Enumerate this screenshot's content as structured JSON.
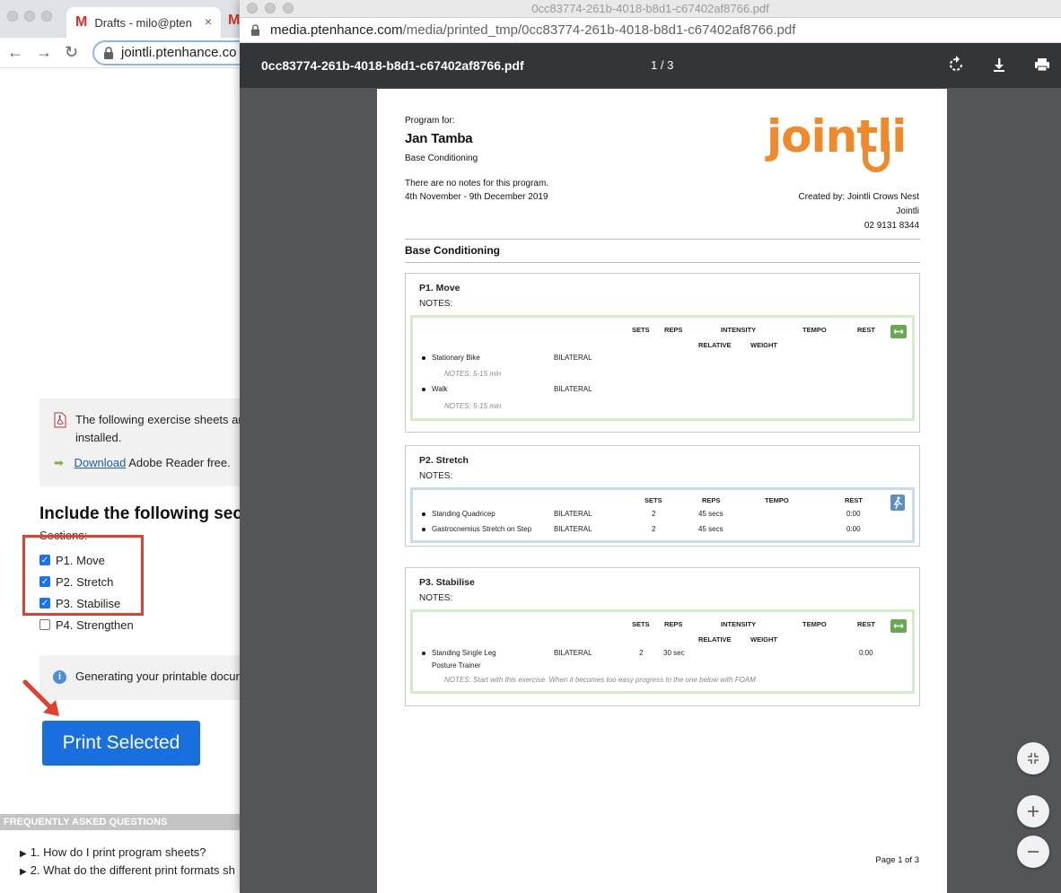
{
  "background": {
    "tab": {
      "title": "Drafts - milo@pten",
      "close": "×"
    },
    "omnibox": "jointli.ptenhance.co",
    "pdf_notice": {
      "text": "The following exercise sheets ar software installed.",
      "download_link": "Download",
      "download_rest": "Adobe Reader free."
    },
    "include_heading": "Include the following sect",
    "sections_label": "Sections:",
    "sections": [
      {
        "label": "P1. Move",
        "checked": true
      },
      {
        "label": "P2. Stretch",
        "checked": true
      },
      {
        "label": "P3. Stabilise",
        "checked": true
      },
      {
        "label": "P4. Strengthen",
        "checked": false
      }
    ],
    "generating_text": "Generating your printable docur",
    "print_button": "Print Selected",
    "faq_header": "FREQUENTLY ASKED QUESTIONS",
    "faq_items": [
      "1. How do I print program sheets?",
      "2. What do the different print formats sh"
    ],
    "colors": {
      "button": "#1a6fde",
      "highlight": "#e53e2c"
    }
  },
  "popup": {
    "window_title": "0cc83774-261b-4018-b8d1-c67402af8766.pdf",
    "url_host": "media.ptenhance.com",
    "url_path": "/media/printed_tmp/0cc83774-261b-4018-b8d1-c67402af8766.pdf",
    "toolbar": {
      "filename": "0cc83774-261b-4018-b8d1-c67402af8766.pdf",
      "page_indicator": "1 / 3",
      "icons": [
        "rotate-icon",
        "download-icon",
        "print-icon"
      ]
    },
    "fabs": [
      "fit-icon",
      "zoom-in-icon",
      "zoom-out-icon"
    ]
  },
  "pdf": {
    "program_for": "Program for:",
    "client_name": "Jan Tamba",
    "program_name": "Base Conditioning",
    "notes_line": "There are no notes for this program.",
    "date_range": "4th November - 9th December 2019",
    "logo_text": "jointli",
    "created_by": "Created by: Jointli Crows Nest",
    "clinic": "Jointli",
    "phone": "02 9131 8344",
    "section_title": "Base Conditioning",
    "footer": "Page 1 of 3",
    "headers": {
      "sets": "SETS",
      "reps": "REPS",
      "intensity": "INTENSITY",
      "tempo": "TEMPO",
      "rest": "REST",
      "relative": "RELATIVE",
      "weight": "WEIGHT"
    },
    "blocks": [
      {
        "title": "P1. Move",
        "notes": "NOTES:",
        "exercises": [
          {
            "name": "Stationary Bike",
            "side": "BILATERAL",
            "note": "NOTES: 5-15 min"
          },
          {
            "name": "Walk",
            "side": "BILATERAL",
            "note": "NOTES: 5-15 min"
          }
        ]
      },
      {
        "title": "P2. Stretch",
        "notes": "NOTES:",
        "exercises": [
          {
            "name": "Standing Quadricep",
            "side": "BILATERAL",
            "sets": "2",
            "reps": "45 secs",
            "rest": "0:00"
          },
          {
            "name": "Gastrocnemius Stretch on Step",
            "side": "BILATERAL",
            "sets": "2",
            "reps": "45 secs",
            "rest": "0:00"
          }
        ]
      },
      {
        "title": "P3. Stabilise",
        "notes": "NOTES:",
        "exercises": [
          {
            "name_line1": "Standing Single Leg",
            "name_line2": "Posture Trainer",
            "side": "BILATERAL",
            "sets": "2",
            "reps": "30 sec",
            "rest": "0:00",
            "note": "NOTES: Start with this exercise. When it becomes too easy progress to the one below with FOAM"
          }
        ]
      }
    ],
    "colors": {
      "logo": "#f0892a",
      "green_border": "#d3ecca",
      "blue_border": "#c6dcef"
    }
  }
}
